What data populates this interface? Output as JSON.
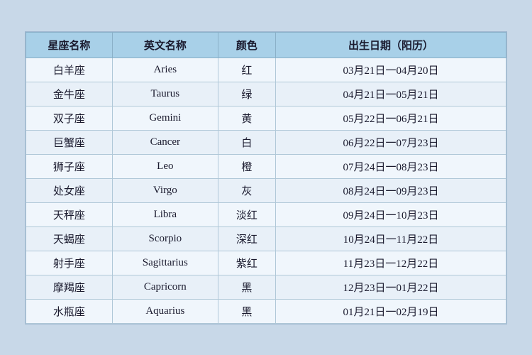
{
  "table": {
    "headers": {
      "zh_name": "星座名称",
      "en_name": "英文名称",
      "color": "颜色",
      "date_range": "出生日期（阳历）"
    },
    "rows": [
      {
        "zh": "白羊座",
        "en": "Aries",
        "color": "红",
        "dates": "03月21日一04月20日"
      },
      {
        "zh": "金牛座",
        "en": "Taurus",
        "color": "绿",
        "dates": "04月21日一05月21日"
      },
      {
        "zh": "双子座",
        "en": "Gemini",
        "color": "黄",
        "dates": "05月22日一06月21日"
      },
      {
        "zh": "巨蟹座",
        "en": "Cancer",
        "color": "白",
        "dates": "06月22日一07月23日"
      },
      {
        "zh": "狮子座",
        "en": "Leo",
        "color": "橙",
        "dates": "07月24日一08月23日"
      },
      {
        "zh": "处女座",
        "en": "Virgo",
        "color": "灰",
        "dates": "08月24日一09月23日"
      },
      {
        "zh": "天秤座",
        "en": "Libra",
        "color": "淡红",
        "dates": "09月24日一10月23日"
      },
      {
        "zh": "天蝎座",
        "en": "Scorpio",
        "color": "深红",
        "dates": "10月24日一11月22日"
      },
      {
        "zh": "射手座",
        "en": "Sagittarius",
        "color": "紫红",
        "dates": "11月23日一12月22日"
      },
      {
        "zh": "摩羯座",
        "en": "Capricorn",
        "color": "黑",
        "dates": "12月23日一01月22日"
      },
      {
        "zh": "水瓶座",
        "en": "Aquarius",
        "color": "黑",
        "dates": "01月21日一02月19日"
      }
    ]
  }
}
